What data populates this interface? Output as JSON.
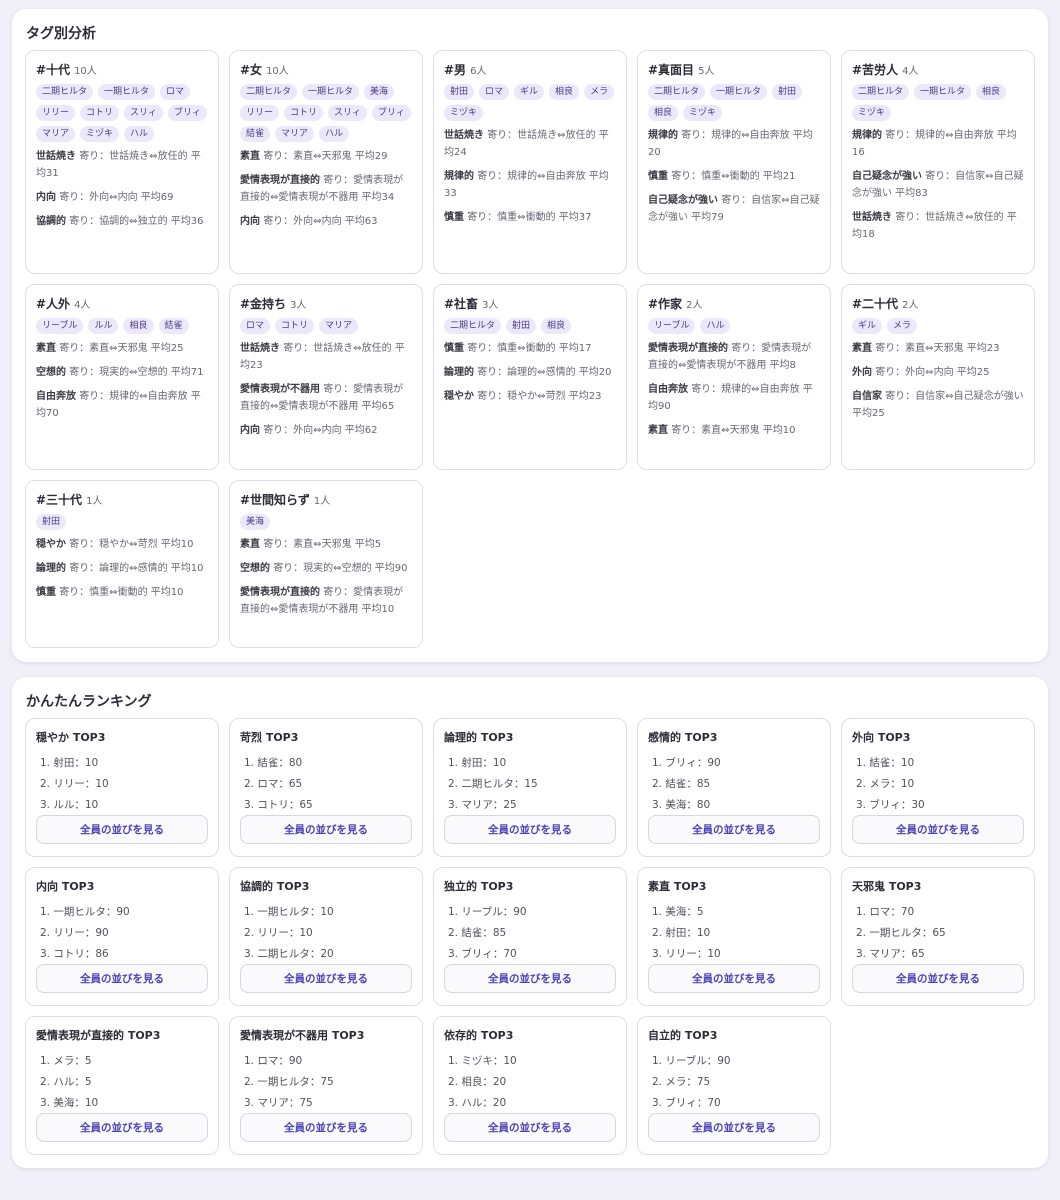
{
  "tag_section": {
    "title": "タグ別分析",
    "cards": [
      {
        "tag": "#十代",
        "count": "10人",
        "members": [
          "二期ヒルタ",
          "一期ヒルタ",
          "ロマ",
          "リリー",
          "コトリ",
          "スリィ",
          "ブリィ",
          "マリア",
          "ミヅキ",
          "ハル"
        ],
        "stats": [
          {
            "label": "世話焼き",
            "text": "寄り：世話焼き⇔放任的 平均31"
          },
          {
            "label": "内向",
            "text": "寄り：外向⇔内向 平均69"
          },
          {
            "label": "協調的",
            "text": "寄り：協調的⇔独立的 平均36"
          }
        ]
      },
      {
        "tag": "#女",
        "count": "10人",
        "members": [
          "二期ヒルタ",
          "一期ヒルタ",
          "美海",
          "リリー",
          "コトリ",
          "スリィ",
          "ブリィ",
          "結雀",
          "マリア",
          "ハル"
        ],
        "stats": [
          {
            "label": "素直",
            "text": "寄り：素直⇔天邪鬼 平均29"
          },
          {
            "label": "愛情表現が直接的",
            "text": "寄り：愛情表現が直接的⇔愛情表現が不器用 平均34"
          },
          {
            "label": "内向",
            "text": "寄り：外向⇔内向 平均63"
          }
        ]
      },
      {
        "tag": "#男",
        "count": "6人",
        "members": [
          "射田",
          "ロマ",
          "ギル",
          "相良",
          "メラ",
          "ミヅキ"
        ],
        "stats": [
          {
            "label": "世話焼き",
            "text": "寄り：世話焼き⇔放任的 平均24"
          },
          {
            "label": "規律的",
            "text": "寄り：規律的⇔自由奔放 平均33"
          },
          {
            "label": "慎重",
            "text": "寄り：慎重⇔衝動的 平均37"
          }
        ]
      },
      {
        "tag": "#真面目",
        "count": "5人",
        "members": [
          "二期ヒルタ",
          "一期ヒルタ",
          "射田",
          "相良",
          "ミヅキ"
        ],
        "stats": [
          {
            "label": "規律的",
            "text": "寄り：規律的⇔自由奔放 平均20"
          },
          {
            "label": "慎重",
            "text": "寄り：慎重⇔衝動的 平均21"
          },
          {
            "label": "自己疑念が強い",
            "text": "寄り：自信家⇔自己疑念が強い 平均79"
          }
        ]
      },
      {
        "tag": "#苦労人",
        "count": "4人",
        "members": [
          "二期ヒルタ",
          "一期ヒルタ",
          "相良",
          "ミヅキ"
        ],
        "stats": [
          {
            "label": "規律的",
            "text": "寄り：規律的⇔自由奔放 平均16"
          },
          {
            "label": "自己疑念が強い",
            "text": "寄り：自信家⇔自己疑念が強い 平均83"
          },
          {
            "label": "世話焼き",
            "text": "寄り：世話焼き⇔放任的 平均18"
          }
        ]
      },
      {
        "tag": "#人外",
        "count": "4人",
        "members": [
          "リーブル",
          "ルル",
          "相良",
          "結雀"
        ],
        "stats": [
          {
            "label": "素直",
            "text": "寄り：素直⇔天邪鬼 平均25"
          },
          {
            "label": "空想的",
            "text": "寄り：現実的⇔空想的 平均71"
          },
          {
            "label": "自由奔放",
            "text": "寄り：規律的⇔自由奔放 平均70"
          }
        ]
      },
      {
        "tag": "#金持ち",
        "count": "3人",
        "members": [
          "ロマ",
          "コトリ",
          "マリア"
        ],
        "stats": [
          {
            "label": "世話焼き",
            "text": "寄り：世話焼き⇔放任的 平均23"
          },
          {
            "label": "愛情表現が不器用",
            "text": "寄り：愛情表現が直接的⇔愛情表現が不器用 平均65"
          },
          {
            "label": "内向",
            "text": "寄り：外向⇔内向 平均62"
          }
        ]
      },
      {
        "tag": "#社畜",
        "count": "3人",
        "members": [
          "二期ヒルタ",
          "射田",
          "相良"
        ],
        "stats": [
          {
            "label": "慎重",
            "text": "寄り：慎重⇔衝動的 平均17"
          },
          {
            "label": "論理的",
            "text": "寄り：論理的⇔感情的 平均20"
          },
          {
            "label": "穏やか",
            "text": "寄り：穏やか⇔苛烈 平均23"
          }
        ]
      },
      {
        "tag": "#作家",
        "count": "2人",
        "members": [
          "リーブル",
          "ハル"
        ],
        "stats": [
          {
            "label": "愛情表現が直接的",
            "text": "寄り：愛情表現が直接的⇔愛情表現が不器用 平均8"
          },
          {
            "label": "自由奔放",
            "text": "寄り：規律的⇔自由奔放 平均90"
          },
          {
            "label": "素直",
            "text": "寄り：素直⇔天邪鬼 平均10"
          }
        ]
      },
      {
        "tag": "#二十代",
        "count": "2人",
        "members": [
          "ギル",
          "メラ"
        ],
        "stats": [
          {
            "label": "素直",
            "text": "寄り：素直⇔天邪鬼 平均23"
          },
          {
            "label": "外向",
            "text": "寄り：外向⇔内向 平均25"
          },
          {
            "label": "自信家",
            "text": "寄り：自信家⇔自己疑念が強い 平均25"
          }
        ]
      },
      {
        "tag": "#三十代",
        "count": "1人",
        "members": [
          "射田"
        ],
        "stats": [
          {
            "label": "穏やか",
            "text": "寄り：穏やか⇔苛烈 平均10"
          },
          {
            "label": "論理的",
            "text": "寄り：論理的⇔感情的 平均10"
          },
          {
            "label": "慎重",
            "text": "寄り：慎重⇔衝動的 平均10"
          }
        ]
      },
      {
        "tag": "#世間知らず",
        "count": "1人",
        "members": [
          "美海"
        ],
        "stats": [
          {
            "label": "素直",
            "text": "寄り：素直⇔天邪鬼 平均5"
          },
          {
            "label": "空想的",
            "text": "寄り：現実的⇔空想的 平均90"
          },
          {
            "label": "愛情表現が直接的",
            "text": "寄り：愛情表現が直接的⇔愛情表現が不器用 平均10"
          }
        ]
      }
    ]
  },
  "ranking_section": {
    "title": "かんたんランキング",
    "button_label": "全員の並びを見る",
    "cards": [
      {
        "title": "穏やか TOP3",
        "items": [
          "1. 射田：10",
          "2. リリー：10",
          "3. ルル：10"
        ]
      },
      {
        "title": "苛烈 TOP3",
        "items": [
          "1. 結雀：80",
          "2. ロマ：65",
          "3. コトリ：65"
        ]
      },
      {
        "title": "論理的 TOP3",
        "items": [
          "1. 射田：10",
          "2. 二期ヒルタ：15",
          "3. マリア：25"
        ]
      },
      {
        "title": "感情的 TOP3",
        "items": [
          "1. ブリィ：90",
          "2. 結雀：85",
          "3. 美海：80"
        ]
      },
      {
        "title": "外向 TOP3",
        "items": [
          "1. 結雀：10",
          "2. メラ：10",
          "3. ブリィ：30"
        ]
      },
      {
        "title": "内向 TOP3",
        "items": [
          "1. 一期ヒルタ：90",
          "2. リリー：90",
          "3. コトリ：86"
        ]
      },
      {
        "title": "協調的 TOP3",
        "items": [
          "1. 一期ヒルタ：10",
          "2. リリー：10",
          "3. 二期ヒルタ：20"
        ]
      },
      {
        "title": "独立的 TOP3",
        "items": [
          "1. リーブル：90",
          "2. 結雀：85",
          "3. ブリィ：70"
        ]
      },
      {
        "title": "素直 TOP3",
        "items": [
          "1. 美海：5",
          "2. 射田：10",
          "3. リリー：10"
        ]
      },
      {
        "title": "天邪鬼 TOP3",
        "items": [
          "1. ロマ：70",
          "2. 一期ヒルタ：65",
          "3. マリア：65"
        ]
      },
      {
        "title": "愛情表現が直接的 TOP3",
        "items": [
          "1. メラ：5",
          "2. ハル：5",
          "3. 美海：10"
        ]
      },
      {
        "title": "愛情表現が不器用 TOP3",
        "items": [
          "1. ロマ：90",
          "2. 一期ヒルタ：75",
          "3. マリア：75"
        ]
      },
      {
        "title": "依存的 TOP3",
        "items": [
          "1. ミヅキ：10",
          "2. 相良：20",
          "3. ハル：20"
        ]
      },
      {
        "title": "自立的 TOP3",
        "items": [
          "1. リーブル：90",
          "2. メラ：75",
          "3. ブリィ：70"
        ]
      }
    ]
  }
}
